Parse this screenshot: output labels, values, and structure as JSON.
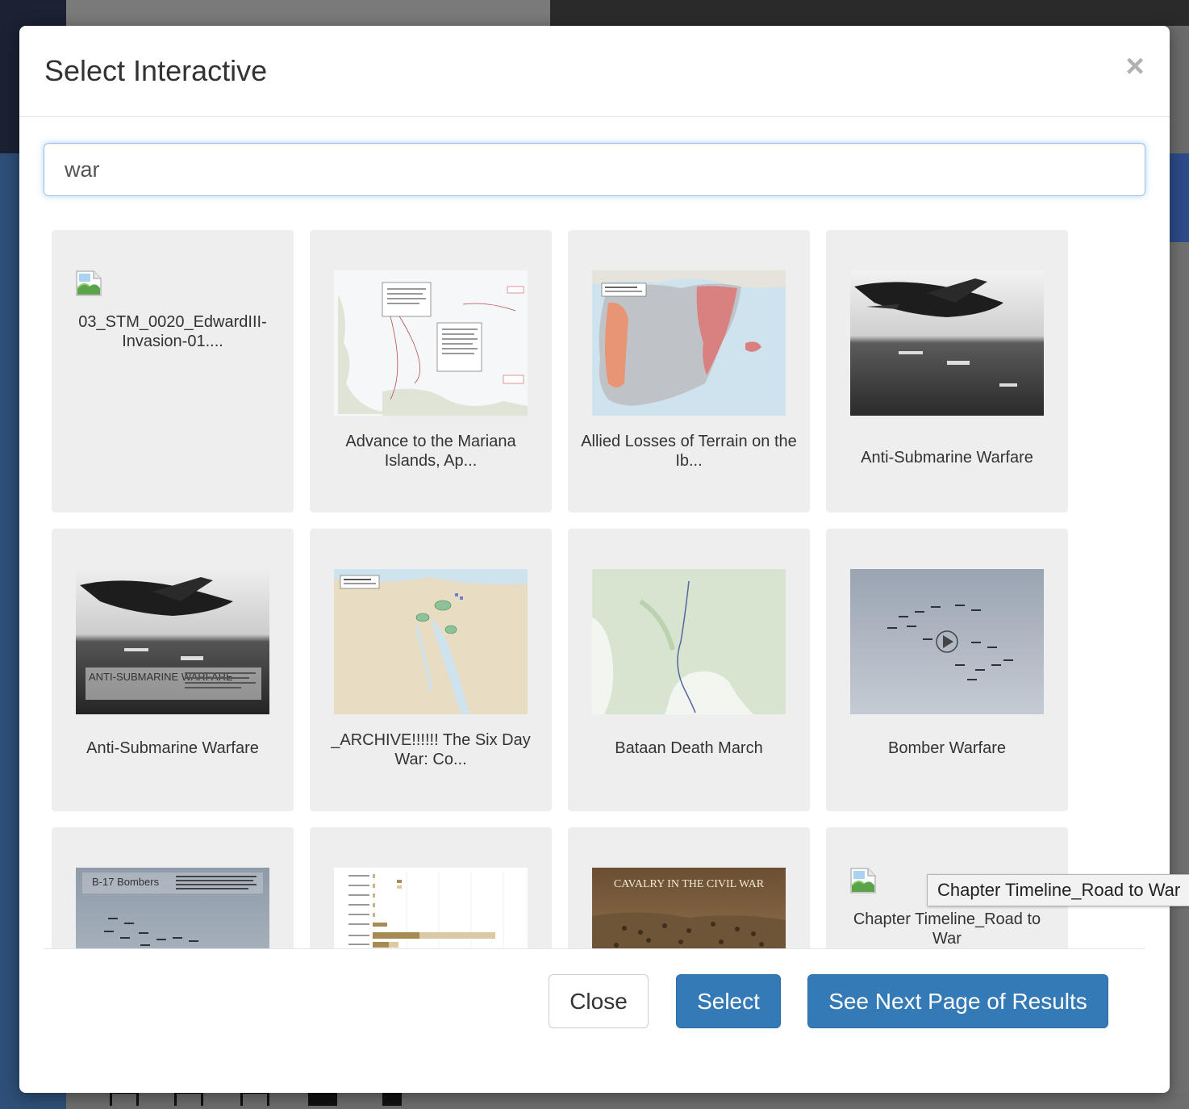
{
  "modal": {
    "title": "Select Interactive",
    "close_icon": "times-icon"
  },
  "search": {
    "value": "war"
  },
  "results": [
    {
      "label": "03_STM_0020_EdwardIII-Invasion-01....",
      "thumbnail": "broken-image-icon"
    },
    {
      "label": "Advance to the Mariana Islands, Ap...",
      "thumbnail": "map-pacific-islands"
    },
    {
      "label": "Allied Losses of Terrain on the Ib...",
      "thumbnail": "map-iberian-peninsula"
    },
    {
      "label": "Anti-Submarine Warfare",
      "thumbnail": "photo-aircraft-over-sea"
    },
    {
      "label": "Anti-Submarine Warfare",
      "thumbnail": "photo-aircraft-over-sea-captioned",
      "overlay_title": "ANTI-SUBMARINE WARFARE"
    },
    {
      "label": "_ARCHIVE!!!!!! The Six Day War: Co...",
      "thumbnail": "map-sinai"
    },
    {
      "label": "Bataan Death March",
      "thumbnail": "map-bataan"
    },
    {
      "label": "Bomber Warfare",
      "thumbnail": "video-bomber-formation"
    },
    {
      "label": "",
      "thumbnail": "b17-bombers",
      "overlay_title": "B-17 Bombers"
    },
    {
      "label": "",
      "thumbnail": "bar-chart"
    },
    {
      "label": "",
      "thumbnail": "cavalry-painting",
      "overlay_title": "CAVALRY IN THE CIVIL WAR"
    },
    {
      "label": "Chapter Timeline_Road to War",
      "thumbnail": "broken-image-icon"
    }
  ],
  "footer": {
    "close_label": "Close",
    "select_label": "Select",
    "next_label": "See Next Page of Results"
  },
  "tooltip": {
    "text": "Chapter Timeline_Road to War"
  },
  "colors": {
    "primary": "#337ab7",
    "card_bg": "#eeeeee",
    "focus_glow": "#66afe9"
  }
}
